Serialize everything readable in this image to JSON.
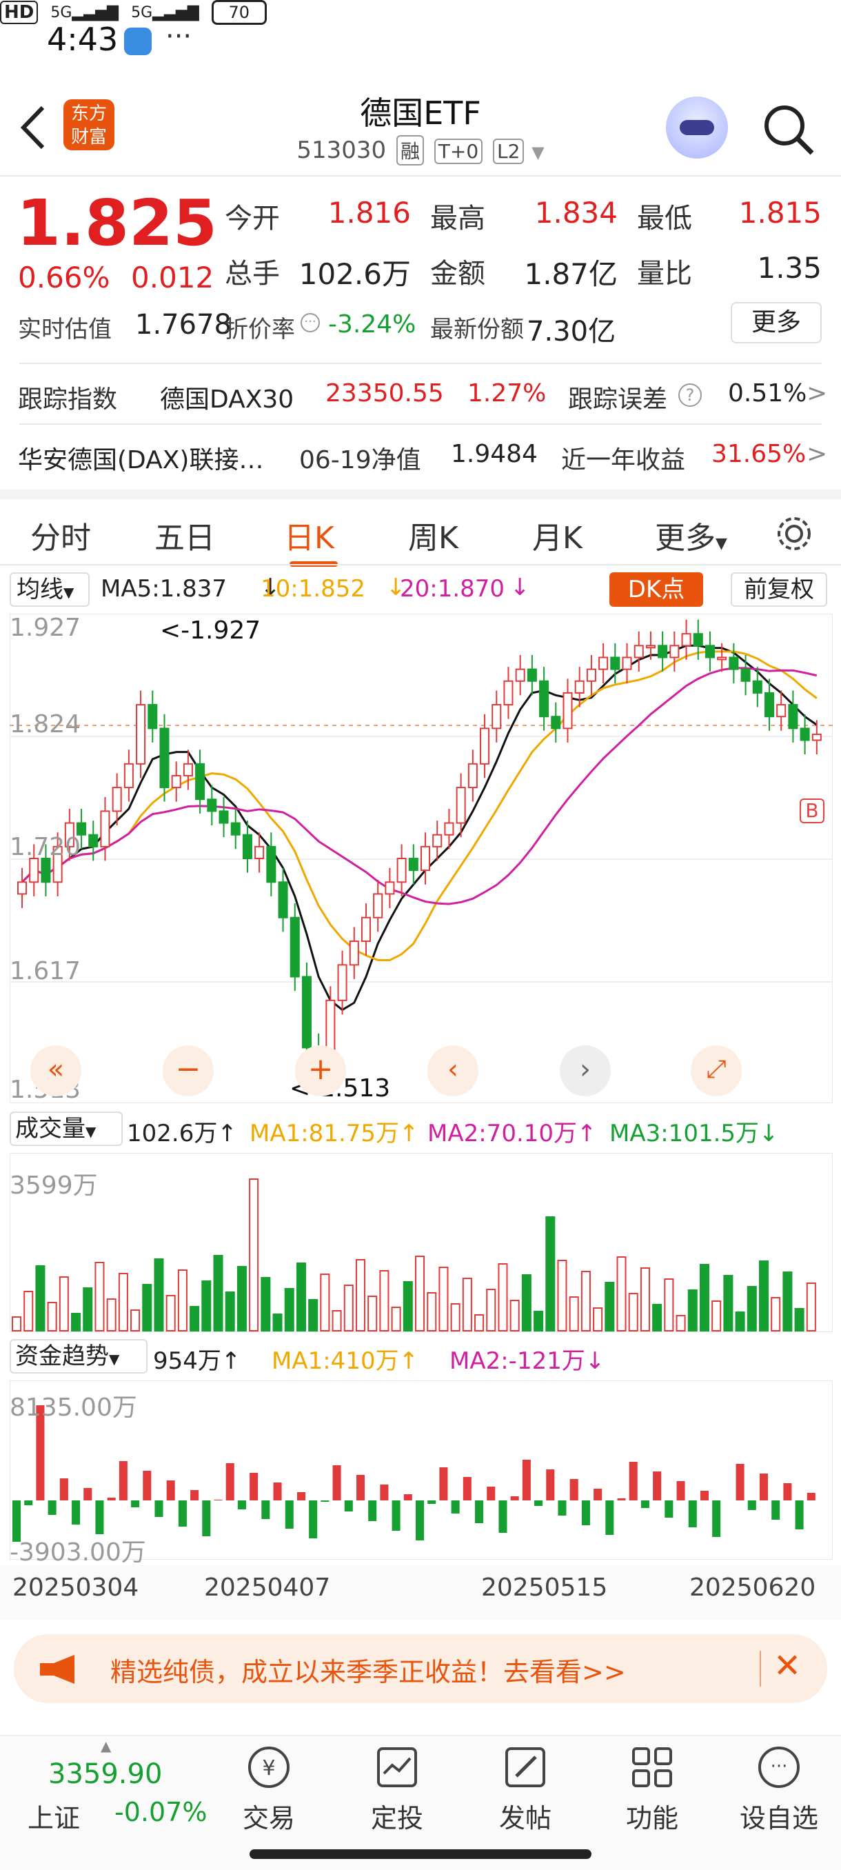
{
  "status": {
    "time": "4:43",
    "hd": "HD",
    "net1": "5G",
    "net2": "5G",
    "battery": "70"
  },
  "header": {
    "title": "德国ETF",
    "code": "513030",
    "tags": [
      "融",
      "T+0",
      "L2"
    ],
    "logo_line1": "东方",
    "logo_line2": "财富"
  },
  "quote": {
    "price": "1.825",
    "change_pct": "0.66%",
    "change": "0.012",
    "open_label": "今开",
    "open": "1.816",
    "high_label": "最高",
    "high": "1.834",
    "low_label": "最低",
    "low": "1.815",
    "vol_label": "总手",
    "vol": "102.6万",
    "amount_label": "金额",
    "amount": "1.87亿",
    "ratio_label": "量比",
    "ratio": "1.35",
    "iopv_label": "实时估值",
    "iopv": "1.7678",
    "discount_label": "折价率",
    "discount": "-3.24%",
    "shares_label": "最新份额",
    "shares": "7.30亿",
    "more_label": "更多"
  },
  "tracking": {
    "label": "跟踪指数",
    "index": "德国DAX30",
    "index_value": "23350.55",
    "index_pct": "1.27%",
    "error_label": "跟踪误差",
    "error": "0.51%",
    "fund": "华安德国(DAX)联接…",
    "nav_label": "06-19净值",
    "nav": "1.9484",
    "yr_label": "近一年收益",
    "yr": "31.65%"
  },
  "tabs": [
    "分时",
    "五日",
    "日K",
    "周K",
    "月K",
    "更多"
  ],
  "kline": {
    "ma_select": "均线",
    "ma5": "MA5:1.837",
    "ma10": "10:1.852",
    "ma20": "20:1.870",
    "dk_label": "DK点",
    "adjust_label": "前复权",
    "y_labels": [
      "1.927",
      "1.824",
      "1.720",
      "1.617",
      "1.513"
    ],
    "high_marker": "<-1.927",
    "low_marker": "<-1.513"
  },
  "volume": {
    "label": "成交量",
    "value": "102.6万",
    "ma1": "MA1:81.75万",
    "ma2": "MA2:70.10万",
    "ma3": "MA3:101.5万",
    "max": "3599万"
  },
  "fund_flow": {
    "label": "资金趋势",
    "value": "954万",
    "ma1": "MA1:410万",
    "ma2": "MA2:-121万",
    "max": "8135.00万",
    "min": "-3903.00万"
  },
  "dates": [
    "20250304",
    "20250407",
    "20250515",
    "20250620"
  ],
  "ad": {
    "text": "精选纯债，成立以来季季正收益！去看看>>"
  },
  "bottom": {
    "index_value": "3359.90",
    "index_name": "上证",
    "index_pct": "-0.07%",
    "items": [
      "交易",
      "定投",
      "发帖",
      "功能",
      "设自选"
    ]
  },
  "chart_data": {
    "type": "candlestick",
    "ylim": [
      1.513,
      1.927
    ],
    "last": 1.825,
    "ma5": 1.837,
    "ma10": 1.852,
    "ma20": 1.87
  }
}
